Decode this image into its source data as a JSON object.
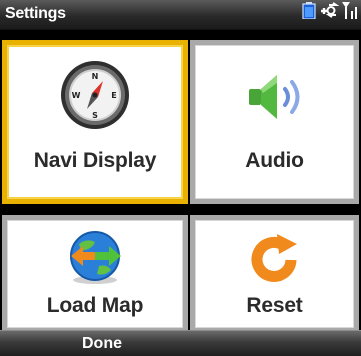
{
  "window": {
    "title": "Settings"
  },
  "status_icons": [
    "battery-icon",
    "connection-icon",
    "signal-icon"
  ],
  "tiles": [
    {
      "label": "Navi Display",
      "icon": "compass-icon",
      "selected": true
    },
    {
      "label": "Audio",
      "icon": "speaker-icon",
      "selected": false
    },
    {
      "label": "Load Map",
      "icon": "globe-map-icon",
      "selected": false
    },
    {
      "label": "Reset",
      "icon": "reset-arrow-icon",
      "selected": false
    }
  ],
  "softkeys": {
    "left": "Done"
  },
  "colors": {
    "selected_border": "#e9b200",
    "tile_border": "#a9a9a9"
  }
}
